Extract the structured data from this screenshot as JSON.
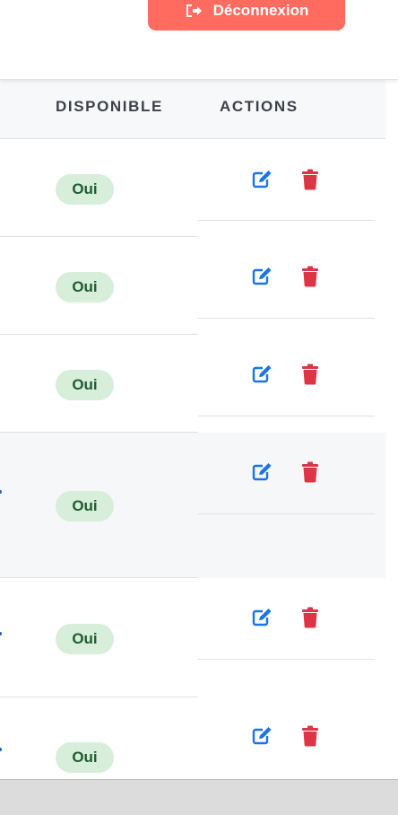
{
  "header": {
    "logout_label": "Déconnexion"
  },
  "table": {
    "columns": {
      "disponible": "DISPONIBLE",
      "actions": "ACTIONS"
    },
    "rows": [
      {
        "disponible": "Oui"
      },
      {
        "disponible": "Oui"
      },
      {
        "disponible": "Oui"
      },
      {
        "disponible": "Oui"
      },
      {
        "disponible": "Oui"
      },
      {
        "disponible": "Oui"
      }
    ]
  },
  "colors": {
    "logout_button": "#ff6b5e",
    "badge_bg": "#d7eedb",
    "badge_text": "#1f5c2f",
    "edit_icon": "#1a73e8",
    "delete_icon": "#dc3545"
  },
  "icons": {
    "logout": "sign-out-icon",
    "edit": "edit-icon",
    "delete": "trash-icon"
  }
}
